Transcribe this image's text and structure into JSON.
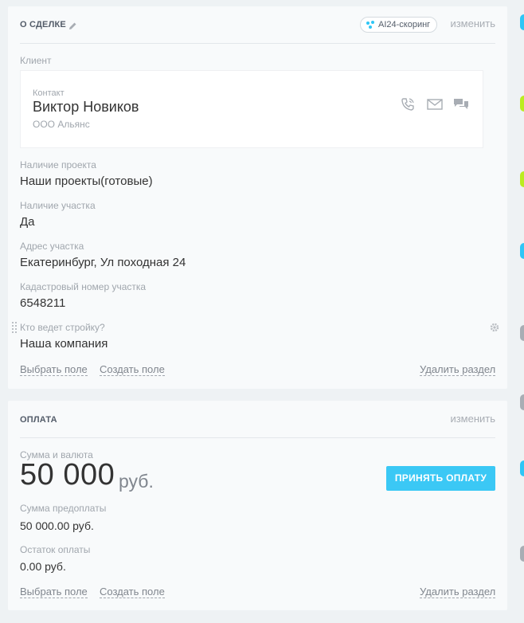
{
  "deal": {
    "title": "О СДЕЛКЕ",
    "scoring_label": "AI24-скоринг",
    "edit_label": "изменить",
    "client": {
      "section_label": "Клиент",
      "contact_label": "Контакт",
      "name": "Виктор Новиков",
      "company": "ООО Альянс",
      "icons": [
        "phone-icon",
        "mail-icon",
        "chat-icon"
      ]
    },
    "fields": [
      {
        "label": "Наличие проекта",
        "value": "Наши проекты(готовые)"
      },
      {
        "label": "Наличие участка",
        "value": "Да"
      },
      {
        "label": "Адрес участка",
        "value": "Екатеринбург, Ул походная 24"
      },
      {
        "label": "Кадастровый номер участка",
        "value": "6548211"
      },
      {
        "label": "Кто ведет стройку?",
        "value": "Наша компания"
      }
    ],
    "footer": {
      "select_field": "Выбрать поле",
      "create_field": "Создать поле",
      "delete_section": "Удалить раздел"
    }
  },
  "payment": {
    "title": "ОПЛАТА",
    "edit_label": "изменить",
    "amount_label": "Сумма и валюта",
    "amount": "50 000",
    "currency": "руб.",
    "accept_button": "ПРИНЯТЬ ОПЛАТУ",
    "fields": [
      {
        "label": "Сумма предоплаты",
        "value": "50 000.00 руб."
      },
      {
        "label": "Остаток оплаты",
        "value": "0.00 руб."
      }
    ],
    "footer": {
      "select_field": "Выбрать поле",
      "create_field": "Создать поле",
      "delete_section": "Удалить раздел"
    }
  },
  "colors": {
    "accent": "#3bc8f5",
    "card_bg": "#f8fafb",
    "page_bg": "#eef2f4",
    "timeline_green": "#bbed21",
    "timeline_blue": "#2fc6f6",
    "timeline_gray": "#a8adb4"
  }
}
